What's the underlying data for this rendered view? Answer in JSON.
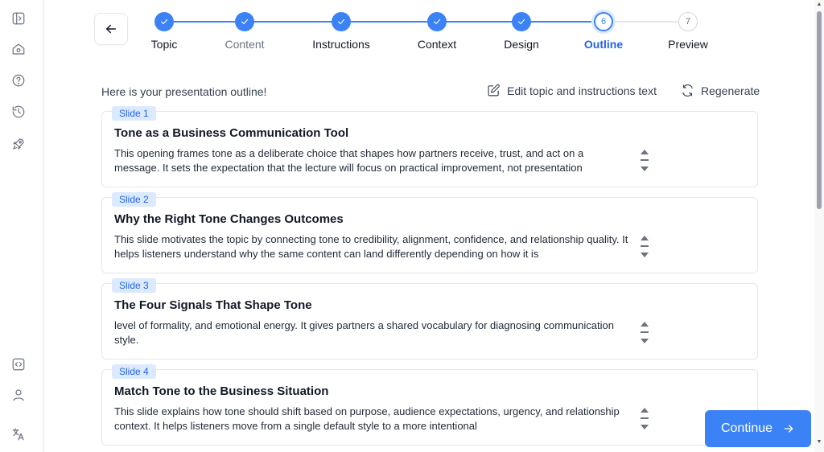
{
  "sidebar": {
    "top_icons": [
      "sidebar-toggle-icon",
      "home-icon",
      "help-icon",
      "history-icon",
      "rocket-icon"
    ],
    "bottom_icons": [
      "code-icon",
      "user-icon",
      "translate-icon"
    ]
  },
  "stepper": {
    "steps": [
      {
        "label": "Topic",
        "state": "done"
      },
      {
        "label": "Content",
        "state": "done"
      },
      {
        "label": "Instructions",
        "state": "done"
      },
      {
        "label": "Context",
        "state": "done"
      },
      {
        "label": "Design",
        "state": "done"
      },
      {
        "label": "Outline",
        "state": "active",
        "number": "6"
      },
      {
        "label": "Preview",
        "state": "pending",
        "number": "7"
      }
    ]
  },
  "header": {
    "intro": "Here is your presentation outline!",
    "edit_label": "Edit topic and instructions text",
    "regenerate_label": "Regenerate"
  },
  "slides": [
    {
      "badge": "Slide 1",
      "title": "Tone as a Business Communication Tool",
      "body": "This opening frames tone as a deliberate choice that shapes how partners receive, trust, and act on a message. It sets the expectation that the lecture will focus on practical improvement, not presentation"
    },
    {
      "badge": "Slide 2",
      "title": "Why the Right Tone Changes Outcomes",
      "body": "This slide motivates the topic by connecting tone to credibility, alignment, confidence, and relationship quality. It helps listeners understand why the same content can land differently depending on how it is"
    },
    {
      "badge": "Slide 3",
      "title": "The Four Signals That Shape Tone",
      "body": "level of formality, and emotional energy. It gives partners a shared vocabulary for diagnosing communication style."
    },
    {
      "badge": "Slide 4",
      "title": "Match Tone to the Business Situation",
      "body": "This slide explains how tone should shift based on purpose, audience expectations, urgency, and relationship context. It helps listeners move from a single default style to a more intentional"
    }
  ],
  "footer": {
    "continue_label": "Continue"
  },
  "colors": {
    "accent": "#3b82f6",
    "badge_bg": "#dbeafe"
  }
}
